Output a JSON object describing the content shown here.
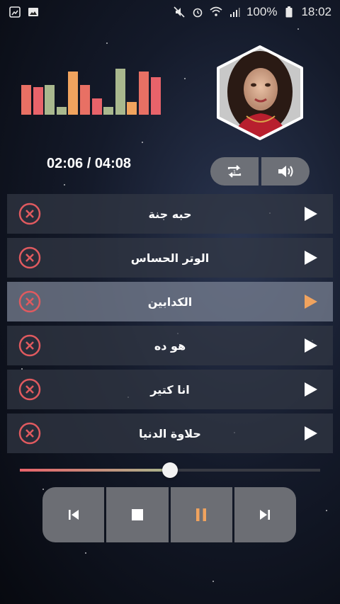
{
  "status_bar": {
    "battery": "100%",
    "time": "18:02",
    "left_icons": [
      "gallery-notification-icon",
      "image-notification-icon"
    ],
    "right_icons": [
      "mute-icon",
      "alarm-icon",
      "wifi-icon",
      "signal-icon",
      "battery-icon"
    ]
  },
  "visualizer": {
    "levels": [
      0.62,
      0.58,
      0.62,
      0.16,
      0.9,
      0.62,
      0.34,
      0.16,
      0.95,
      0.26,
      0.9,
      0.78
    ],
    "colors": [
      "#e87064",
      "#e8636a",
      "#a9b88e",
      "#a9b88e",
      "#f0a35e",
      "#e87064",
      "#e8636a",
      "#a9b88e",
      "#a9b88e",
      "#f0a35e",
      "#e87064",
      "#e8636a"
    ]
  },
  "player": {
    "time_display": "02:06 / 04:08",
    "progress": 0.5
  },
  "controls": {
    "repeat_icon": "repeat-one-icon",
    "volume_icon": "volume-icon"
  },
  "songs": [
    {
      "title": "حبه جنة",
      "active": false
    },
    {
      "title": "الوتر الحساس",
      "active": false
    },
    {
      "title": "الكدابين",
      "active": true
    },
    {
      "title": "هو ده",
      "active": false
    },
    {
      "title": "انا كتير",
      "active": false
    },
    {
      "title": "حلاوة الدنيا",
      "active": false
    }
  ],
  "transport": {
    "buttons": [
      "previous-icon",
      "stop-icon",
      "pause-icon",
      "next-icon"
    ]
  },
  "colors": {
    "remove": "#e05a5f",
    "accent": "#f0a35e",
    "play": "#ffffff"
  }
}
